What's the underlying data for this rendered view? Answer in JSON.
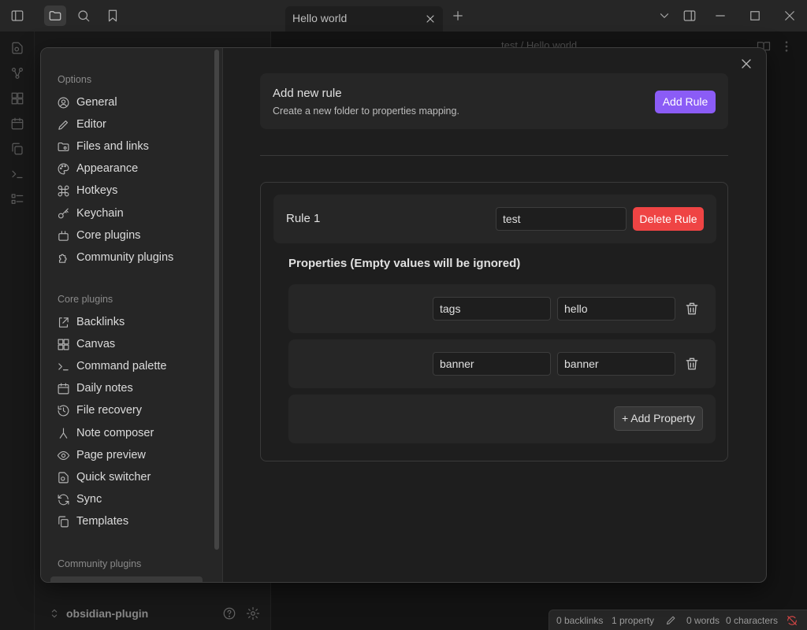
{
  "window": {
    "tab_title": "Hello world",
    "breadcrumb_folder": "test",
    "breadcrumb_sep": "/",
    "breadcrumb_file": "Hello world"
  },
  "vault": {
    "name": "obsidian-plugin"
  },
  "statusbar": {
    "backlinks": "0 backlinks",
    "properties": "1 property",
    "words": "0 words",
    "characters": "0 characters"
  },
  "settings_nav": {
    "options_heading": "Options",
    "options": [
      {
        "label": "General",
        "icon": "user-circle-icon"
      },
      {
        "label": "Editor",
        "icon": "pencil-icon"
      },
      {
        "label": "Files and links",
        "icon": "folder-cog-icon"
      },
      {
        "label": "Appearance",
        "icon": "palette-icon"
      },
      {
        "label": "Hotkeys",
        "icon": "command-icon"
      },
      {
        "label": "Keychain",
        "icon": "key-icon"
      },
      {
        "label": "Core plugins",
        "icon": "plug-icon"
      },
      {
        "label": "Community plugins",
        "icon": "puzzle-icon"
      }
    ],
    "core_heading": "Core plugins",
    "core": [
      {
        "label": "Backlinks",
        "icon": "link-icon"
      },
      {
        "label": "Canvas",
        "icon": "layout-dashboard-icon"
      },
      {
        "label": "Command palette",
        "icon": "terminal-icon"
      },
      {
        "label": "Daily notes",
        "icon": "calendar-icon"
      },
      {
        "label": "File recovery",
        "icon": "history-icon"
      },
      {
        "label": "Note composer",
        "icon": "merge-icon"
      },
      {
        "label": "Page preview",
        "icon": "eye-icon"
      },
      {
        "label": "Quick switcher",
        "icon": "file-search-icon"
      },
      {
        "label": "Sync",
        "icon": "refresh-icon"
      },
      {
        "label": "Templates",
        "icon": "files-icon"
      }
    ],
    "community_heading": "Community plugins"
  },
  "plugin_settings": {
    "add_rule": {
      "title": "Add new rule",
      "description": "Create a new folder to properties mapping.",
      "button": "Add Rule"
    },
    "rule": {
      "title": "Rule 1",
      "folder_value": "test",
      "delete_button": "Delete Rule",
      "properties_heading": "Properties (Empty values will be ignored)",
      "properties": [
        {
          "key": "tags",
          "value": "hello"
        },
        {
          "key": "banner",
          "value": "banner"
        }
      ],
      "add_property_button": "+ Add Property"
    }
  },
  "colors": {
    "accent": "#8b5cf6",
    "danger": "#ef4444",
    "background": "#1e1e1e",
    "surface": "#262626"
  }
}
